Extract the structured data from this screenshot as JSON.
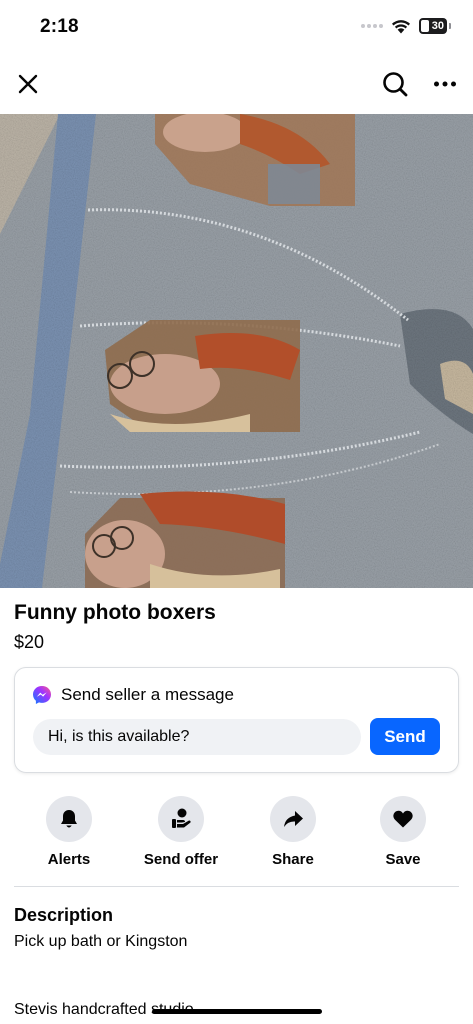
{
  "status_bar": {
    "time": "2:18",
    "battery": "30"
  },
  "nav": {
    "close_icon": "close-icon",
    "search_icon": "search-icon",
    "more_icon": "more-horizontal-icon"
  },
  "listing": {
    "title": "Funny photo boxers",
    "price": "$20"
  },
  "message": {
    "heading": "Send seller a message",
    "input_value": "Hi, is this available?",
    "send_label": "Send",
    "messenger_icon": "messenger-icon"
  },
  "actions": [
    {
      "label": "Alerts",
      "icon": "bell-icon"
    },
    {
      "label": "Send offer",
      "icon": "offer-icon"
    },
    {
      "label": "Share",
      "icon": "share-arrow-icon"
    },
    {
      "label": "Save",
      "icon": "heart-icon"
    }
  ],
  "description": {
    "heading": "Description",
    "body": "Pick up bath or Kingston",
    "extra": "Stevis handcrafted studio"
  },
  "colors": {
    "accent": "#0866ff",
    "button_bg": "#e4e6eb",
    "input_bg": "#f0f2f5",
    "text": "#050505"
  }
}
